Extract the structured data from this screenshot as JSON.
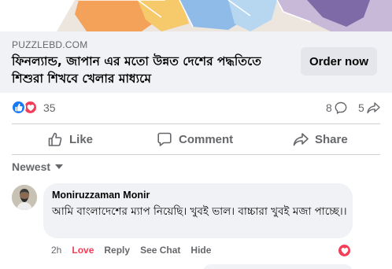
{
  "ad": {
    "image_icon": "map-illustration",
    "domain": "PUZZLEBD.COM",
    "headline": "ফিনল্যান্ড, জাপান এর মতো উন্নত দেশের পদ্ধতিতে শিশুরা শিখবে খেলার মাধ্যমে",
    "cta_label": "Order now"
  },
  "reactions": {
    "icons": [
      "like-icon",
      "love-icon"
    ],
    "count": "35",
    "comments_count": "8",
    "shares_count": "5"
  },
  "actions": {
    "like_label": "Like",
    "comment_label": "Comment",
    "share_label": "Share"
  },
  "comments_sort": {
    "label": "Newest"
  },
  "comment": {
    "author": "Moniruzzaman Monir",
    "text": "আমি বাংলাদেশের ম্যাপ নিয়েছি। খুবই ভাল। বাচ্চারা খুবই মজা পাচ্ছে।।",
    "time": "2h",
    "love_label": "Love",
    "reply_label": "Reply",
    "see_chat_label": "See Chat",
    "hide_label": "Hide",
    "reaction_icon": "love-icon"
  },
  "colors": {
    "brand_blue": "#1877f2",
    "love_red": "#f33e58",
    "secondary_text": "#65676b",
    "surface": "#f0f2f5"
  }
}
